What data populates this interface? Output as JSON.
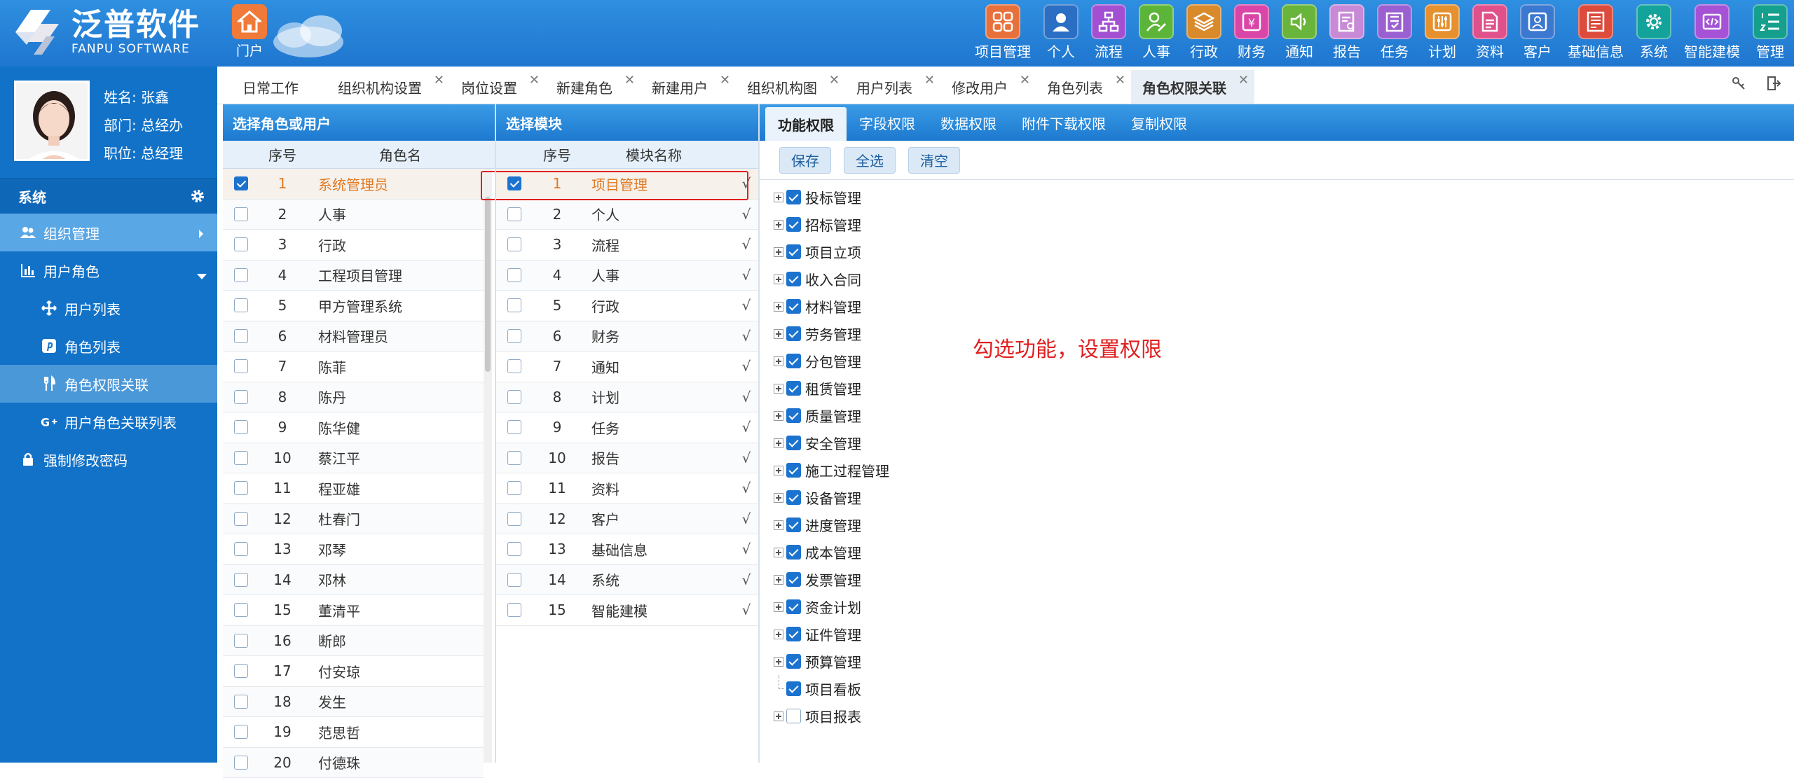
{
  "brand": {
    "cn": "泛普软件",
    "en": "FANPU SOFTWARE"
  },
  "portal": {
    "label": "门户"
  },
  "modules": [
    {
      "label": "项目管理",
      "icon": "grid-icon",
      "color": "#e8703a"
    },
    {
      "label": "个人",
      "icon": "person-icon",
      "color": "#2a6fc4"
    },
    {
      "label": "流程",
      "icon": "flow-icon",
      "color": "#a24fd1"
    },
    {
      "label": "人事",
      "icon": "user-edit-icon",
      "color": "#5cb538"
    },
    {
      "label": "行政",
      "icon": "layers-icon",
      "color": "#d98a2b"
    },
    {
      "label": "财务",
      "icon": "yen-icon",
      "color": "#d946a8"
    },
    {
      "label": "通知",
      "icon": "speaker-icon",
      "color": "#69b43a"
    },
    {
      "label": "报告",
      "icon": "report-icon",
      "color": "#c889d6"
    },
    {
      "label": "任务",
      "icon": "task-icon",
      "color": "#9a5fd0"
    },
    {
      "label": "计划",
      "icon": "sliders-icon",
      "color": "#e6902e"
    },
    {
      "label": "资料",
      "icon": "document-icon",
      "color": "#e0508b"
    },
    {
      "label": "客户",
      "icon": "customer-icon",
      "color": "#3b78d0"
    },
    {
      "label": "基础信息",
      "icon": "info-doc-icon",
      "color": "#dc4b3c"
    },
    {
      "label": "系统",
      "icon": "gear-icon",
      "color": "#14a39a"
    },
    {
      "label": "智能建模",
      "icon": "code-icon",
      "color": "#a552d6"
    },
    {
      "label": "管理",
      "icon": "list-order-icon",
      "color": "#15a08e"
    }
  ],
  "profile": {
    "name": "姓名: 张鑫",
    "dept": "部门: 总经办",
    "position": "职位: 总经理"
  },
  "sidebar": {
    "section": "系统",
    "items": [
      {
        "label": "组织管理",
        "icon": "users-icon",
        "level": 1
      },
      {
        "label": "用户角色",
        "icon": "bar-chart-icon",
        "level": 1
      },
      {
        "label": "用户列表",
        "icon": "move-icon",
        "level": 2
      },
      {
        "label": "角色列表",
        "icon": "pinterest-icon",
        "level": 2
      },
      {
        "label": "角色权限关联",
        "icon": "cutlery-icon",
        "level": 2
      },
      {
        "label": "用户角色关联列表",
        "icon": "google-plus-icon",
        "level": 2
      },
      {
        "label": "强制修改密码",
        "icon": "lock-icon",
        "level": 1
      }
    ]
  },
  "tabs": [
    {
      "label": "日常工作",
      "closable": false
    },
    {
      "label": "组织机构设置",
      "closable": true
    },
    {
      "label": "岗位设置",
      "closable": true
    },
    {
      "label": "新建角色",
      "closable": true
    },
    {
      "label": "新建用户",
      "closable": true
    },
    {
      "label": "组织机构图",
      "closable": true
    },
    {
      "label": "用户列表",
      "closable": true
    },
    {
      "label": "修改用户",
      "closable": true
    },
    {
      "label": "角色列表",
      "closable": true
    },
    {
      "label": "角色权限关联",
      "closable": true,
      "active": true
    }
  ],
  "left_panel": {
    "title": "选择角色或用户",
    "col_no": "序号",
    "col_name": "角色名",
    "rows": [
      {
        "no": "1",
        "name": "系统管理员",
        "checked": true
      },
      {
        "no": "2",
        "name": "人事"
      },
      {
        "no": "3",
        "name": "行政"
      },
      {
        "no": "4",
        "name": "工程项目管理"
      },
      {
        "no": "5",
        "name": "甲方管理系统"
      },
      {
        "no": "6",
        "name": "材料管理员"
      },
      {
        "no": "7",
        "name": "陈菲"
      },
      {
        "no": "8",
        "name": "陈丹"
      },
      {
        "no": "9",
        "name": "陈华健"
      },
      {
        "no": "10",
        "name": "蔡江平"
      },
      {
        "no": "11",
        "name": "程亚雄"
      },
      {
        "no": "12",
        "name": "杜春门"
      },
      {
        "no": "13",
        "name": "邓琴"
      },
      {
        "no": "14",
        "name": "邓林"
      },
      {
        "no": "15",
        "name": "董清平"
      },
      {
        "no": "16",
        "name": "断郎"
      },
      {
        "no": "17",
        "name": "付安琼"
      },
      {
        "no": "18",
        "name": "发生"
      },
      {
        "no": "19",
        "name": "范思哲"
      },
      {
        "no": "20",
        "name": "付德珠"
      }
    ]
  },
  "mid_panel": {
    "title": "选择模块",
    "col_no": "序号",
    "col_name": "模块名称",
    "check_mark": "√",
    "rows": [
      {
        "no": "1",
        "name": "项目管理",
        "checked": true
      },
      {
        "no": "2",
        "name": "个人"
      },
      {
        "no": "3",
        "name": "流程"
      },
      {
        "no": "4",
        "name": "人事"
      },
      {
        "no": "5",
        "name": "行政"
      },
      {
        "no": "6",
        "name": "财务"
      },
      {
        "no": "7",
        "name": "通知"
      },
      {
        "no": "8",
        "name": "计划"
      },
      {
        "no": "9",
        "name": "任务"
      },
      {
        "no": "10",
        "name": "报告"
      },
      {
        "no": "11",
        "name": "资料"
      },
      {
        "no": "12",
        "name": "客户"
      },
      {
        "no": "13",
        "name": "基础信息"
      },
      {
        "no": "14",
        "name": "系统"
      },
      {
        "no": "15",
        "name": "智能建模"
      }
    ]
  },
  "perm_tabs": [
    "功能权限",
    "字段权限",
    "数据权限",
    "附件下载权限",
    "复制权限"
  ],
  "toolbar": {
    "save": "保存",
    "select_all": "全选",
    "clear": "清空"
  },
  "tree": [
    {
      "label": "投标管理",
      "checked": true,
      "expandable": true
    },
    {
      "label": "招标管理",
      "checked": true,
      "expandable": true
    },
    {
      "label": "项目立项",
      "checked": true,
      "expandable": true
    },
    {
      "label": "收入合同",
      "checked": true,
      "expandable": true
    },
    {
      "label": "材料管理",
      "checked": true,
      "expandable": true
    },
    {
      "label": "劳务管理",
      "checked": true,
      "expandable": true
    },
    {
      "label": "分包管理",
      "checked": true,
      "expandable": true
    },
    {
      "label": "租赁管理",
      "checked": true,
      "expandable": true
    },
    {
      "label": "质量管理",
      "checked": true,
      "expandable": true
    },
    {
      "label": "安全管理",
      "checked": true,
      "expandable": true
    },
    {
      "label": "施工过程管理",
      "checked": true,
      "expandable": true
    },
    {
      "label": "设备管理",
      "checked": true,
      "expandable": true
    },
    {
      "label": "进度管理",
      "checked": true,
      "expandable": true
    },
    {
      "label": "成本管理",
      "checked": true,
      "expandable": true
    },
    {
      "label": "发票管理",
      "checked": true,
      "expandable": true
    },
    {
      "label": "资金计划",
      "checked": true,
      "expandable": true
    },
    {
      "label": "证件管理",
      "checked": true,
      "expandable": true
    },
    {
      "label": "预算管理",
      "checked": true,
      "expandable": true
    },
    {
      "label": "项目看板",
      "checked": true,
      "expandable": false
    },
    {
      "label": "项目报表",
      "checked": false,
      "expandable": true
    }
  ],
  "annotation": "勾选功能，设置权限"
}
